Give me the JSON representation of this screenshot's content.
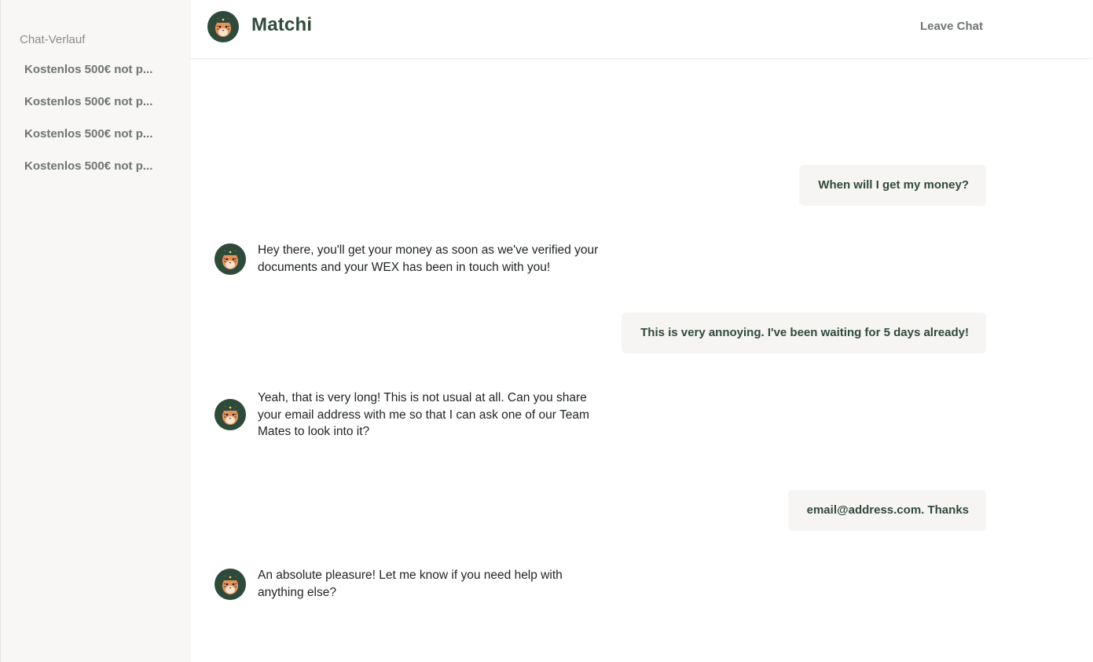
{
  "sidebar": {
    "title": "Chat-Verlauf",
    "items": [
      {
        "label": "Kostenlos 500€ not p..."
      },
      {
        "label": "Kostenlos 500€ not p..."
      },
      {
        "label": "Kostenlos 500€ not p..."
      },
      {
        "label": "Kostenlos 500€ not p..."
      }
    ]
  },
  "header": {
    "title": "Matchi",
    "leave_label": "Leave Chat",
    "avatar_icon": "tiger-avatar-icon"
  },
  "messages": [
    {
      "from": "user",
      "text": "When will I get my money?"
    },
    {
      "from": "bot",
      "text": "Hey there, you'll get your money as soon as we've verified your documents and your WEX has been in touch with you!"
    },
    {
      "from": "user",
      "text": "This is very annoying. I've been waiting for 5 days already!"
    },
    {
      "from": "bot",
      "text": "Yeah, that is very long! This is not usual at all. Can you share your email address with me so that I can ask one of our Team Mates to look into it?"
    },
    {
      "from": "user",
      "text": "email@address.com. Thanks"
    },
    {
      "from": "bot",
      "text": "An absolute pleasure! Let me know if you need help with anything else?"
    }
  ],
  "colors": {
    "brand": "#2f4a3b",
    "sidebar_bg": "#f8f7f5",
    "user_bubble_bg": "#f6f5f3",
    "avatar_bg": "#2e4a3b",
    "tiger_orange": "#e8935a"
  }
}
